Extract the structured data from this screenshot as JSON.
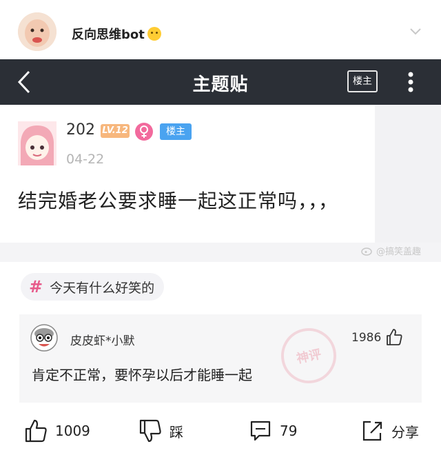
{
  "weibo_header": {
    "account_name": "反向思维bot",
    "emoji_icon": "thinking-face-emoji",
    "chevron_icon": "chevron-down-icon"
  },
  "nav": {
    "title": "主题贴",
    "op_only_label": "楼主",
    "back_icon": "back-arrow-icon",
    "more_icon": "more-vertical-icon"
  },
  "post": {
    "username": "202",
    "level_badge": "LV.12",
    "gender_icon": "female-icon",
    "op_badge": "楼主",
    "date": "04-22",
    "title": "结完婚老公要求睡一起这正常吗，，，",
    "watermark": "@搞笑盖趣"
  },
  "tag": {
    "label": "今天有什么好笑的"
  },
  "hot_comment": {
    "username": "皮皮虾*小默",
    "like_count": "1986",
    "text": "肯定不正常，要怀孕以后才能睡一起",
    "stamp_text": "神评"
  },
  "actions": {
    "like_count": "1009",
    "dislike_label": "踩",
    "comment_count": "79",
    "share_label": "分享"
  },
  "colors": {
    "nav_bg": "#2b2f36",
    "level_badge": "#f7b77d",
    "female_badge": "#f26a9d",
    "op_badge": "#4aa3f0",
    "tag_hash": "#e75a8a"
  }
}
